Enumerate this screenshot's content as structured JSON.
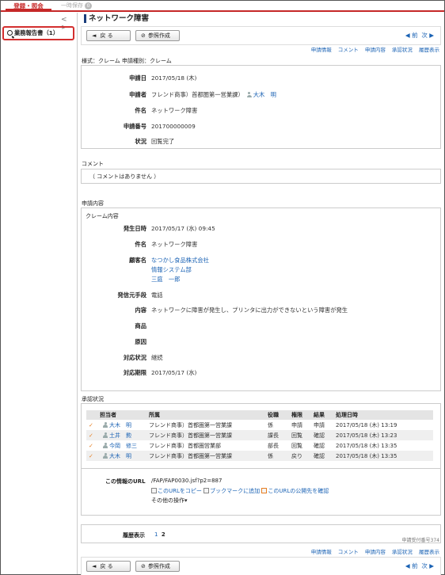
{
  "tabs": {
    "active": "登録・照会",
    "temp_save": "一時保存",
    "temp_count": "0"
  },
  "sidebar": {
    "nav": "< >",
    "item": "業務報告書（1）"
  },
  "page": {
    "title": "ネットワーク障害"
  },
  "toolbar": {
    "back": "戻 る",
    "ref": "参照作成",
    "prev": "前",
    "next": "次"
  },
  "links": {
    "a": "申請情報",
    "b": "コメント",
    "c": "申請内容",
    "d": "承認状況",
    "e": "履歴表示"
  },
  "app_info": {
    "type_line": "様式：クレーム 申請種別：クレーム",
    "rows": [
      {
        "k": "申請日",
        "v": "2017/05/18 (木)"
      },
      {
        "k": "申請者",
        "v": "フレンド商事）首都圏第一営業課）",
        "person": "大木　明"
      },
      {
        "k": "件名",
        "v": "ネットワーク障害"
      },
      {
        "k": "申請番号",
        "v": "201700000009"
      },
      {
        "k": "状況",
        "v": "回覧完了"
      }
    ]
  },
  "comment": {
    "title": "コメント",
    "text": "（ コメントはありません ）"
  },
  "content": {
    "title": "申請内容",
    "sub": "クレーム内容",
    "rows": [
      {
        "k": "発生日時",
        "v": "2017/05/17 (水) 09:45"
      },
      {
        "k": "件名",
        "v": "ネットワーク障害"
      },
      {
        "k": "顧客名",
        "v": "なつかし食品株式会社",
        "v2": "情報システム部",
        "v3": "三庭　一郎"
      },
      {
        "k": "発信元手段",
        "v": "電話"
      },
      {
        "k": "内容",
        "v": "ネットワークに障害が発生し、プリンタに出力ができないという障害が発生"
      },
      {
        "k": "商品",
        "v": ""
      },
      {
        "k": "原因",
        "v": ""
      },
      {
        "k": "対応状況",
        "v": "継続"
      },
      {
        "k": "対応期限",
        "v": "2017/05/17 (水)"
      }
    ]
  },
  "approval": {
    "title": "承認状況",
    "headers": [
      "担当者",
      "所属",
      "役職",
      "権限",
      "結果",
      "処理日時"
    ],
    "rows": [
      {
        "name": "大木　明",
        "dept": "フレンド商事）首都圏第一営業課",
        "pos": "係",
        "auth": "申請",
        "result": "申請",
        "date": "2017/05/18 (木) 13:19"
      },
      {
        "name": "土井　勲",
        "dept": "フレンド商事）首都圏第一営業課",
        "pos": "課長",
        "auth": "回覧",
        "result": "確認",
        "date": "2017/05/18 (木) 13:23"
      },
      {
        "name": "今岡　修三",
        "dept": "フレンド商事）首都圏営業部",
        "pos": "部長",
        "auth": "回覧",
        "result": "確認",
        "date": "2017/05/18 (木) 13:35"
      },
      {
        "name": "大木　明",
        "dept": "フレンド商事）首都圏第一営業課",
        "pos": "係",
        "auth": "戻り",
        "result": "確認",
        "date": "2017/05/18 (木) 13:35"
      }
    ]
  },
  "url_info": {
    "label": "この情報のURL",
    "url": "/FAP/FAP0030.jsf?p2=887",
    "copy": "このURLをコピー",
    "bookmark": "ブックマークに追加",
    "publish": "このURLの公開先を確認",
    "other": "その他の操作▾"
  },
  "history": {
    "label": "履歴表示",
    "p1": "1",
    "p2": "2"
  },
  "receipt": "申請受付番号374"
}
